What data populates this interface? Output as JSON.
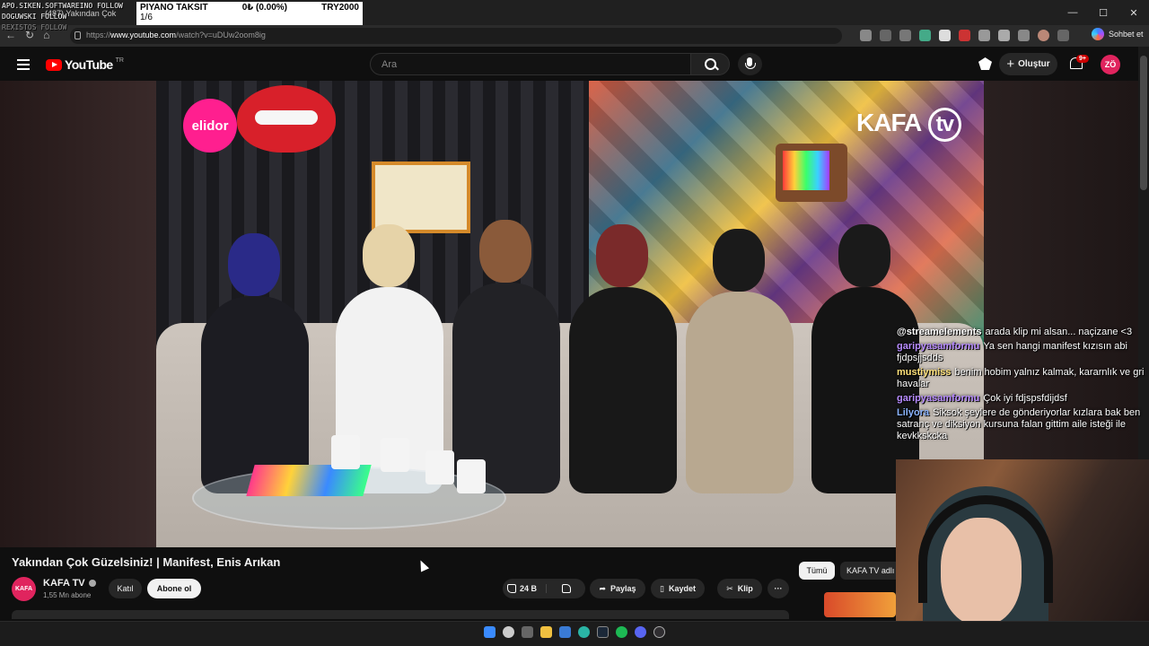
{
  "browser": {
    "tab_title": "(487) Yakından Çok",
    "url_prefix": "https://",
    "url_host": "www.youtube.com",
    "url_path": "/watch?v=uDUw2oom8ig",
    "copilot_label": "Sohbet et"
  },
  "overlays": {
    "follow_lines": [
      "APO.SIKEN.SOFTWAREINO FOLLOW",
      "DOGUWSKI FOLLOW",
      "REXISTOS FOLLOW"
    ],
    "ticker_name": "PIYANO TAKSIT",
    "ticker_amount": "0₺ (0.00%)",
    "ticker_goal": "TRY2000",
    "ticker_progress": "1/6"
  },
  "youtube": {
    "logo_text": "YouTube",
    "country_code": "TR",
    "search_placeholder": "Ara",
    "create_label": "Oluştur",
    "notification_count": "9+",
    "avatar_initials": "ZÖ"
  },
  "video": {
    "sponsor_text": "elidor",
    "brand_text": "KAFA",
    "brand_tv": "tv",
    "title": "Yakından Çok Güzelsiniz! | Manifest, Enis Arıkan",
    "channel_name": "KAFA TV",
    "channel_avatar_text": "KAFA",
    "subscribers": "1,55 Mn abone",
    "join_label": "Katıl",
    "subscribe_label": "Abone ol",
    "like_count": "24 B",
    "share_label": "Paylaş",
    "save_label": "Kaydet",
    "clip_label": "Klip",
    "more_label": "···"
  },
  "sidebar_chips": {
    "all": "Tümü",
    "channel": "KAFA TV adlı"
  },
  "chat": [
    {
      "user": "@streamelements",
      "text": "arada klip mi alsan... naçizane <3",
      "color": "#ffffff"
    },
    {
      "user": "garipyasamformu",
      "text": "Ya sen hangi manifest kızısın abi fjdpsjjsdds",
      "color": "#b78bff"
    },
    {
      "user": "mustiymiss",
      "text": "benim hobim yalnız kalmak, kararnlık ve gri havalar",
      "color": "#ffe27a"
    },
    {
      "user": "garipyasamformu",
      "text": "Çok iyi fdjspsfdijdsf",
      "color": "#b78bff"
    },
    {
      "user": "Lilyora",
      "text": "Siksok şeylere de gönderiyorlar kızlara bak ben satranç ve diksiyon kursuna falan gittim aile isteği ile kevkkskcka",
      "color": "#8ab4ff"
    }
  ],
  "colors": {
    "accent_red": "#ff0000",
    "subscribe_bg": "#f1f1f1"
  }
}
